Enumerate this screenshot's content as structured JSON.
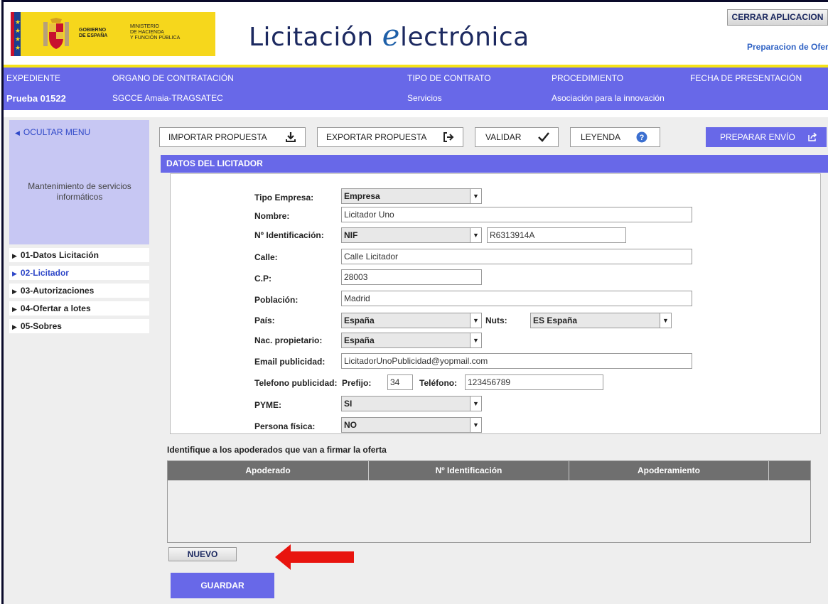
{
  "header": {
    "gov_line1": "GOBIERNO",
    "gov_line2": "DE ESPAÑA",
    "min_line1": "MINISTERIO",
    "min_line2": "DE HACIENDA",
    "min_line3": "Y FUNCIÓN PÚBLICA",
    "title_pre": "Licitación ",
    "title_e": "e",
    "title_post": "lectrónica",
    "close_label": "CERRAR APLICACION",
    "prep_link": "Preparacion de Ofert"
  },
  "info": {
    "expediente_label": "EXPEDIENTE",
    "expediente_value": "Prueba 01522",
    "organo_label": "ORGANO DE CONTRATACIÓN",
    "organo_value": "SGCCE Amaia-TRAGSATEC",
    "tipo_label": "TIPO DE CONTRATO",
    "tipo_value": "Servicios",
    "proc_label": "PROCEDIMIENTO",
    "proc_value": "Asociación para la innovación",
    "fecha_label": "FECHA DE PRESENTACIÓN"
  },
  "sidebar": {
    "hide_label": "OCULTAR MENU",
    "desc_line1": "Mantenimiento de servicios",
    "desc_line2": "informáticos",
    "items": [
      {
        "label": "01-Datos Licitación"
      },
      {
        "label": "02-Licitador"
      },
      {
        "label": "03-Autorizaciones"
      },
      {
        "label": "04-Ofertar a lotes"
      },
      {
        "label": "05-Sobres"
      }
    ]
  },
  "toolbar": {
    "import_label": "IMPORTAR PROPUESTA",
    "export_label": "EXPORTAR PROPUESTA",
    "validate_label": "VALIDAR",
    "legend_label": "LEYENDA",
    "send_label": "PREPARAR ENVÍO"
  },
  "section": {
    "title": "DATOS DEL LICITADOR"
  },
  "form": {
    "tipo_empresa_label": "Tipo Empresa:",
    "tipo_empresa_value": "Empresa",
    "nombre_label": "Nombre:",
    "nombre_value": "Licitador Uno",
    "nid_label": "Nº Identificación:",
    "nid_type": "NIF",
    "nid_value": "R6313914A",
    "calle_label": "Calle:",
    "calle_value": "Calle Licitador",
    "cp_label": "C.P:",
    "cp_value": "28003",
    "poblacion_label": "Población:",
    "poblacion_value": "Madrid",
    "pais_label": "País:",
    "pais_value": "España",
    "nuts_label": "Nuts:",
    "nuts_value": "ES España",
    "nac_label": "Nac. propietario:",
    "nac_value": "España",
    "email_label": "Email publicidad:",
    "email_value": "LicitadorUnoPublicidad@yopmail.com",
    "tel_label": "Telefono publicidad:",
    "prefijo_label": "Prefijo:",
    "prefijo_value": "34",
    "telefono_label": "Teléfono:",
    "telefono_value": "123456789",
    "pyme_label": "PYME:",
    "pyme_value": "SI",
    "persona_label": "Persona física:",
    "persona_value": "NO"
  },
  "apoderados": {
    "title": "Identifique a los apoderados que van a firmar la oferta",
    "columns": [
      "Apoderado",
      "Nº Identificación",
      "Apoderamiento"
    ],
    "new_label": "NUEVO",
    "save_label": "GUARDAR"
  }
}
